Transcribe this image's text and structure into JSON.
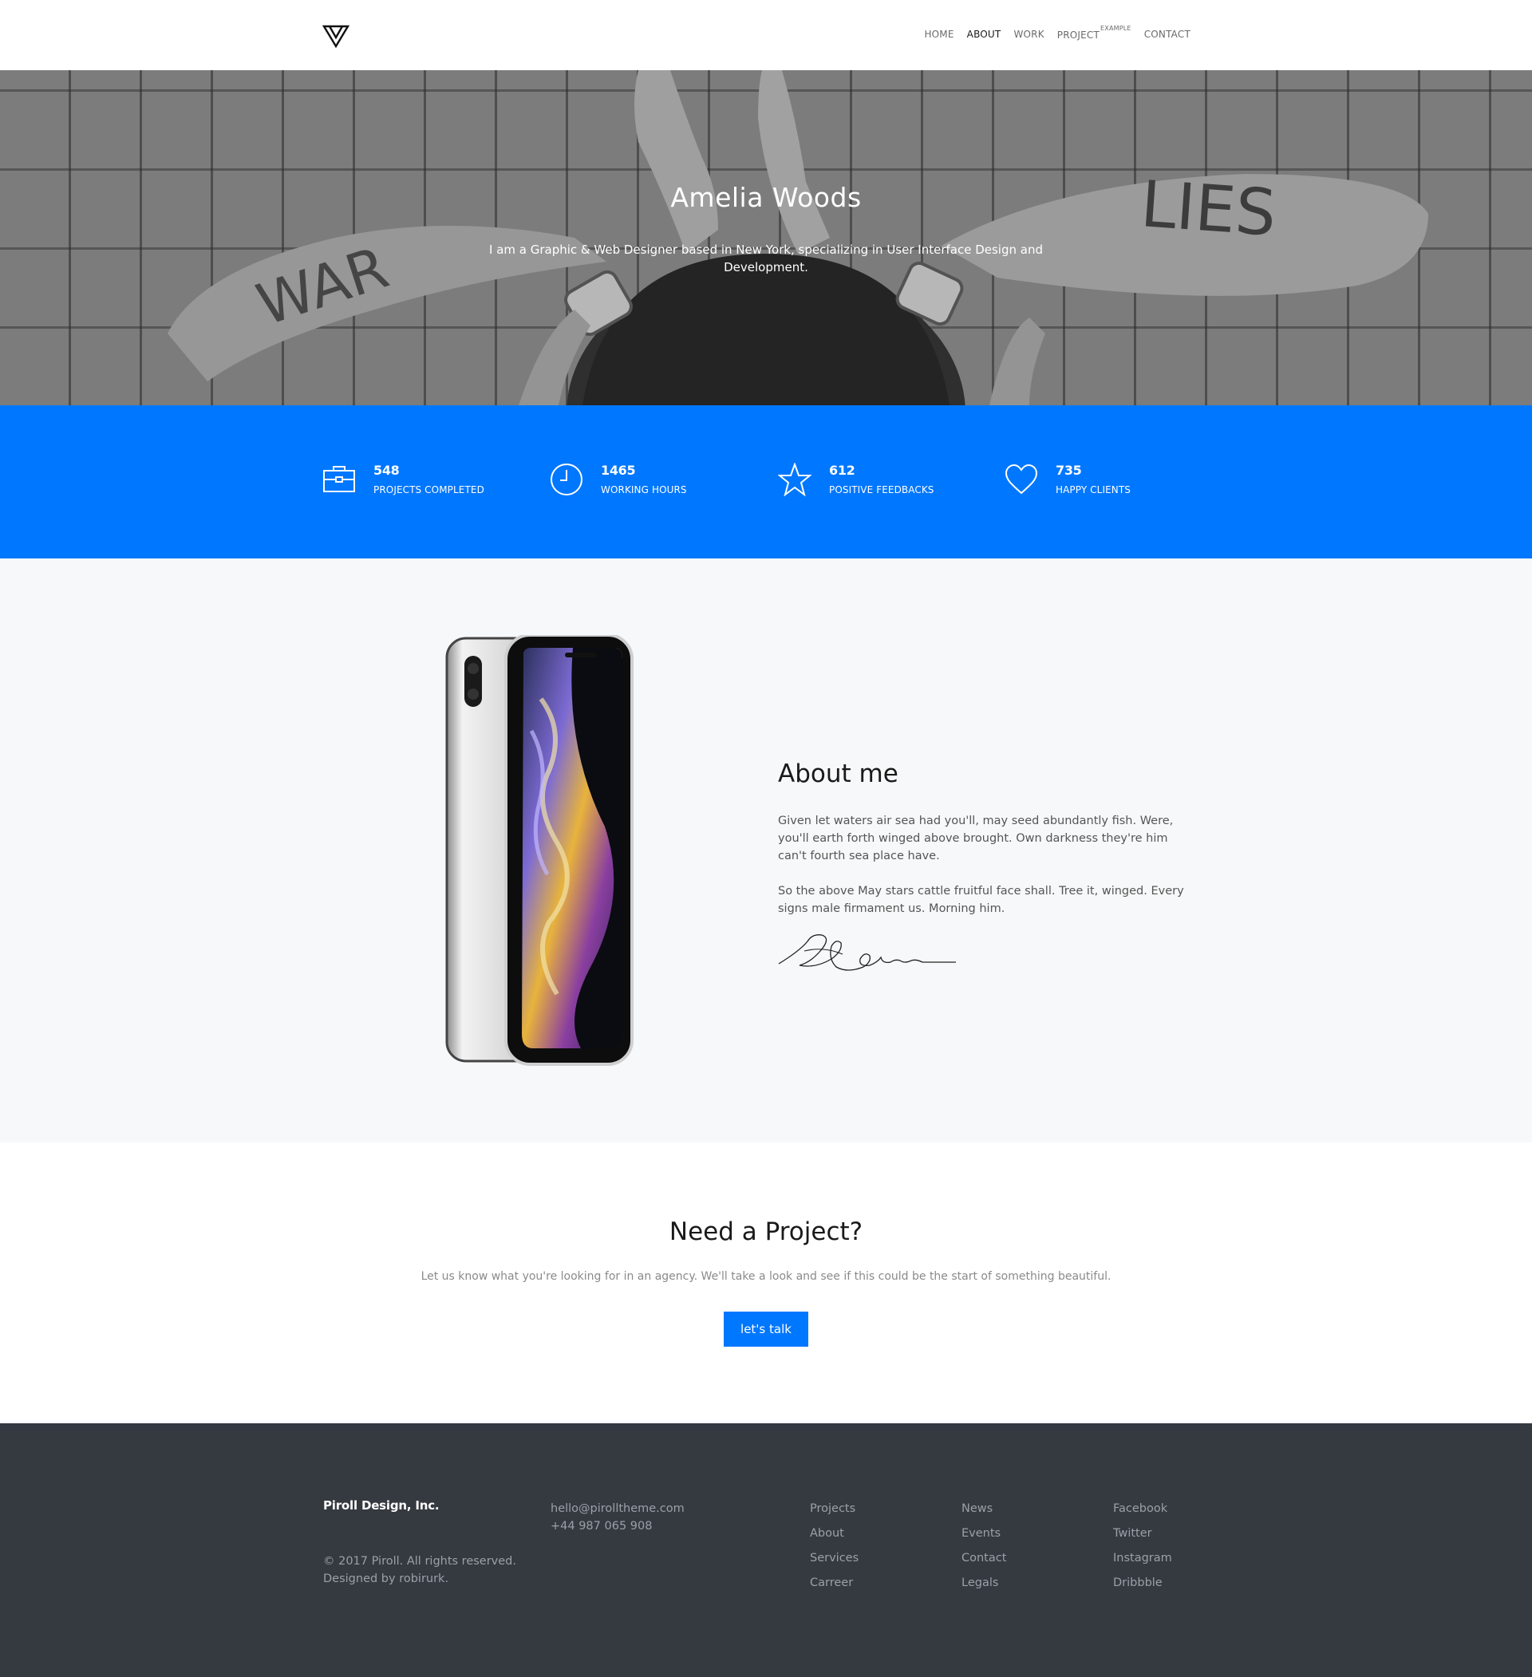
{
  "nav": {
    "links": [
      {
        "label": "HOME",
        "active": false
      },
      {
        "label": "ABOUT",
        "active": true
      },
      {
        "label": "WORK",
        "active": false
      },
      {
        "label": "PROJECT",
        "sup": "EXAMPLE",
        "active": false
      },
      {
        "label": "CONTACT",
        "active": false
      }
    ]
  },
  "hero": {
    "title": "Amelia Woods",
    "subtitle": "I am a Graphic & Web Designer based in New York, specializing in User Interface Design and Development.",
    "arm_text_left": "WAR",
    "arm_text_right": "LIES"
  },
  "stats": [
    {
      "value": "548",
      "label": "PROJECTS COMPLETED",
      "icon": "briefcase-icon"
    },
    {
      "value": "1465",
      "label": "WORKING HOURS",
      "icon": "clock-icon"
    },
    {
      "value": "612",
      "label": "POSITIVE FEEDBACKS",
      "icon": "star-icon"
    },
    {
      "value": "735",
      "label": "HAPPY CLIENTS",
      "icon": "heart-icon"
    }
  ],
  "about": {
    "title": "About me",
    "paragraph1": "Given let waters air sea had you'll, may seed abundantly fish. Were, you'll earth forth winged above brought. Own darkness they're him can't fourth sea place have.",
    "paragraph2": "So the above May stars cattle fruitful face shall. Tree it, winged. Every signs male firmament us. Morning him."
  },
  "cta": {
    "title": "Need a Project?",
    "subtitle": "Let us know what you're looking for in an agency. We'll take a look and see if this could be the start of something beautiful.",
    "button": "let's talk"
  },
  "footer": {
    "company": "Piroll Design, Inc.",
    "copyright": "© 2017 Piroll. All rights reserved.",
    "designed_by": "Designed by robirurk.",
    "email": "hello@pirolltheme.com",
    "phone": "+44 987 065 908",
    "col1": [
      "Projects",
      "About",
      "Services",
      "Carreer"
    ],
    "col2": [
      "News",
      "Events",
      "Contact",
      "Legals"
    ],
    "col3": [
      "Facebook",
      "Twitter",
      "Instagram",
      "Dribbble"
    ]
  },
  "colors": {
    "accent": "#0077ff",
    "footer_bg": "#353940",
    "about_bg": "#f7f8f9"
  }
}
